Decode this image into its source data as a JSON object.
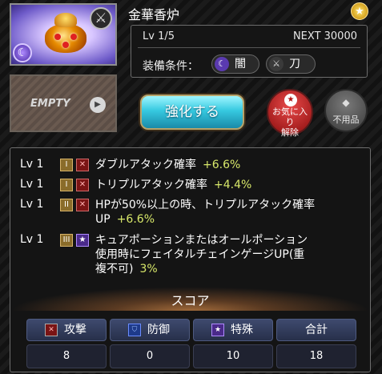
{
  "item": {
    "name": "金華香炉",
    "element_icon": "dark-moon-icon",
    "weapon_icon": "crossed-swords-icon"
  },
  "empty": {
    "label": "EMPTY"
  },
  "info": {
    "level": "Lv 1/5",
    "next": "NEXT 30000",
    "equip_label": "装備条件：",
    "element": "闇",
    "weapon": "刀"
  },
  "actions": {
    "enhance": "強化する",
    "favorite_line1": "お気に入り",
    "favorite_line2": "解除",
    "junk": "不用品"
  },
  "skills": [
    {
      "level": "Lv 1",
      "rank": "I",
      "type": "attack",
      "text": "ダブルアタック確率",
      "value": "+6.6%"
    },
    {
      "level": "Lv 1",
      "rank": "I",
      "type": "attack",
      "text": "トリプルアタック確率",
      "value": "+4.4%"
    },
    {
      "level": "Lv 1",
      "rank": "II",
      "type": "attack",
      "text1": "HPが50%以上の時、トリプルアタック確率",
      "text2": "UP",
      "value": "+6.6%"
    },
    {
      "level": "Lv 1",
      "rank": "III",
      "type": "special",
      "text1": "キュアポーションまたはオールポーション",
      "text2": "使用時にフェイタルチェインゲージUP(重",
      "text3": "複不可)",
      "value": "3%"
    }
  ],
  "score": {
    "title": "スコア",
    "columns": [
      {
        "label": "攻撃",
        "value": "8",
        "icon": "attack-icon"
      },
      {
        "label": "防御",
        "value": "0",
        "icon": "shield-icon"
      },
      {
        "label": "特殊",
        "value": "10",
        "icon": "star-icon"
      },
      {
        "label": "合計",
        "value": "18"
      }
    ]
  },
  "colors": {
    "accent_value": "#d8e86a",
    "enhance_button": "#36c9e0",
    "favorite_button": "#c82020"
  }
}
